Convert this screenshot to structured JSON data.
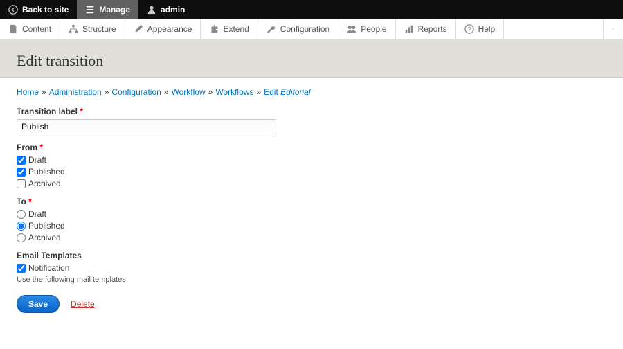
{
  "toolbar_top": {
    "back": "Back to site",
    "manage": "Manage",
    "user": "admin"
  },
  "admin_menu": [
    "Content",
    "Structure",
    "Appearance",
    "Extend",
    "Configuration",
    "People",
    "Reports",
    "Help"
  ],
  "page_title": "Edit transition",
  "breadcrumb": {
    "home": "Home",
    "administration": "Administration",
    "configuration": "Configuration",
    "workflow": "Workflow",
    "workflows": "Workflows",
    "edit_prefix": "Edit ",
    "edit_name": "Editorial"
  },
  "form": {
    "label": {
      "title": "Transition label",
      "value": "Publish"
    },
    "from": {
      "title": "From",
      "options": [
        {
          "label": "Draft",
          "checked": true
        },
        {
          "label": "Published",
          "checked": true
        },
        {
          "label": "Archived",
          "checked": false
        }
      ]
    },
    "to": {
      "title": "To",
      "options": [
        {
          "label": "Draft",
          "checked": false
        },
        {
          "label": "Published",
          "checked": true
        },
        {
          "label": "Archived",
          "checked": false
        }
      ]
    },
    "email_templates": {
      "title": "Email Templates",
      "options": [
        {
          "label": "Notification",
          "checked": true
        }
      ],
      "help": "Use the following mail templates"
    },
    "actions": {
      "save": "Save",
      "delete": "Delete"
    }
  }
}
